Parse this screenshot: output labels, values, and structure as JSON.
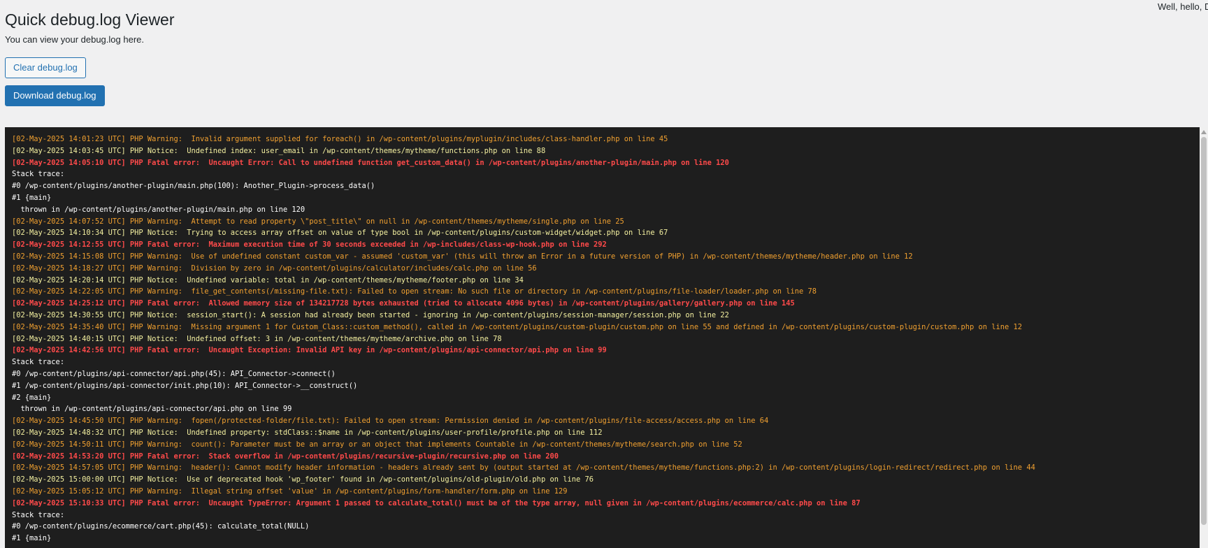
{
  "header": {
    "greeting": "Well, hello, Do"
  },
  "page": {
    "title": "Quick debug.log Viewer",
    "subtitle": "You can view your debug.log here."
  },
  "buttons": {
    "clear_label": "Clear debug.log",
    "download_label": "Download debug.log"
  },
  "colors": {
    "warning": "#f0a030",
    "notice": "#f4f0a0",
    "fatal": "#ff4a4a",
    "plain": "#ffffff",
    "primary": "#2271b1"
  },
  "log": [
    {
      "level": "warning",
      "text": "[02-May-2025 14:01:23 UTC] PHP Warning:  Invalid argument supplied for foreach() in /wp-content/plugins/myplugin/includes/class-handler.php on line 45"
    },
    {
      "level": "notice",
      "text": "[02-May-2025 14:03:45 UTC] PHP Notice:  Undefined index: user_email in /wp-content/themes/mytheme/functions.php on line 88"
    },
    {
      "level": "fatal",
      "text": "[02-May-2025 14:05:10 UTC] PHP Fatal error:  Uncaught Error: Call to undefined function get_custom_data() in /wp-content/plugins/another-plugin/main.php on line 120"
    },
    {
      "level": "plain",
      "text": "Stack trace:"
    },
    {
      "level": "plain",
      "text": "#0 /wp-content/plugins/another-plugin/main.php(100): Another_Plugin->process_data()"
    },
    {
      "level": "plain",
      "text": "#1 {main}"
    },
    {
      "level": "plain",
      "text": "  thrown in /wp-content/plugins/another-plugin/main.php on line 120"
    },
    {
      "level": "warning",
      "text": "[02-May-2025 14:07:52 UTC] PHP Warning:  Attempt to read property \\\"post_title\\\" on null in /wp-content/themes/mytheme/single.php on line 25"
    },
    {
      "level": "notice",
      "text": "[02-May-2025 14:10:34 UTC] PHP Notice:  Trying to access array offset on value of type bool in /wp-content/plugins/custom-widget/widget.php on line 67"
    },
    {
      "level": "fatal",
      "text": "[02-May-2025 14:12:55 UTC] PHP Fatal error:  Maximum execution time of 30 seconds exceeded in /wp-includes/class-wp-hook.php on line 292"
    },
    {
      "level": "warning",
      "text": "[02-May-2025 14:15:08 UTC] PHP Warning:  Use of undefined constant custom_var - assumed 'custom_var' (this will throw an Error in a future version of PHP) in /wp-content/themes/mytheme/header.php on line 12"
    },
    {
      "level": "warning",
      "text": "[02-May-2025 14:18:27 UTC] PHP Warning:  Division by zero in /wp-content/plugins/calculator/includes/calc.php on line 56"
    },
    {
      "level": "notice",
      "text": "[02-May-2025 14:20:14 UTC] PHP Notice:  Undefined variable: total in /wp-content/themes/mytheme/footer.php on line 34"
    },
    {
      "level": "warning",
      "text": "[02-May-2025 14:22:05 UTC] PHP Warning:  file_get_contents(/missing-file.txt): Failed to open stream: No such file or directory in /wp-content/plugins/file-loader/loader.php on line 78"
    },
    {
      "level": "fatal",
      "text": "[02-May-2025 14:25:12 UTC] PHP Fatal error:  Allowed memory size of 134217728 bytes exhausted (tried to allocate 4096 bytes) in /wp-content/plugins/gallery/gallery.php on line 145"
    },
    {
      "level": "notice",
      "text": "[02-May-2025 14:30:55 UTC] PHP Notice:  session_start(): A session had already been started - ignoring in /wp-content/plugins/session-manager/session.php on line 22"
    },
    {
      "level": "warning",
      "text": "[02-May-2025 14:35:40 UTC] PHP Warning:  Missing argument 1 for Custom_Class::custom_method(), called in /wp-content/plugins/custom-plugin/custom.php on line 55 and defined in /wp-content/plugins/custom-plugin/custom.php on line 12"
    },
    {
      "level": "notice",
      "text": "[02-May-2025 14:40:15 UTC] PHP Notice:  Undefined offset: 3 in /wp-content/themes/mytheme/archive.php on line 78"
    },
    {
      "level": "fatal",
      "text": "[02-May-2025 14:42:56 UTC] PHP Fatal error:  Uncaught Exception: Invalid API key in /wp-content/plugins/api-connector/api.php on line 99"
    },
    {
      "level": "plain",
      "text": "Stack trace:"
    },
    {
      "level": "plain",
      "text": "#0 /wp-content/plugins/api-connector/api.php(45): API_Connector->connect()"
    },
    {
      "level": "plain",
      "text": "#1 /wp-content/plugins/api-connector/init.php(10): API_Connector->__construct()"
    },
    {
      "level": "plain",
      "text": "#2 {main}"
    },
    {
      "level": "plain",
      "text": "  thrown in /wp-content/plugins/api-connector/api.php on line 99"
    },
    {
      "level": "warning",
      "text": "[02-May-2025 14:45:50 UTC] PHP Warning:  fopen(/protected-folder/file.txt): Failed to open stream: Permission denied in /wp-content/plugins/file-access/access.php on line 64"
    },
    {
      "level": "notice",
      "text": "[02-May-2025 14:48:32 UTC] PHP Notice:  Undefined property: stdClass::$name in /wp-content/plugins/user-profile/profile.php on line 112"
    },
    {
      "level": "warning",
      "text": "[02-May-2025 14:50:11 UTC] PHP Warning:  count(): Parameter must be an array or an object that implements Countable in /wp-content/themes/mytheme/search.php on line 52"
    },
    {
      "level": "fatal",
      "text": "[02-May-2025 14:53:20 UTC] PHP Fatal error:  Stack overflow in /wp-content/plugins/recursive-plugin/recursive.php on line 200"
    },
    {
      "level": "warning",
      "text": "[02-May-2025 14:57:05 UTC] PHP Warning:  header(): Cannot modify header information - headers already sent by (output started at /wp-content/themes/mytheme/functions.php:2) in /wp-content/plugins/login-redirect/redirect.php on line 44"
    },
    {
      "level": "notice",
      "text": "[02-May-2025 15:00:00 UTC] PHP Notice:  Use of deprecated hook 'wp_footer' found in /wp-content/plugins/old-plugin/old.php on line 76"
    },
    {
      "level": "warning",
      "text": "[02-May-2025 15:05:12 UTC] PHP Warning:  Illegal string offset 'value' in /wp-content/plugins/form-handler/form.php on line 129"
    },
    {
      "level": "fatal",
      "text": "[02-May-2025 15:10:33 UTC] PHP Fatal error:  Uncaught TypeError: Argument 1 passed to calculate_total() must be of the type array, null given in /wp-content/plugins/ecommerce/calc.php on line 87"
    },
    {
      "level": "plain",
      "text": "Stack trace:"
    },
    {
      "level": "plain",
      "text": "#0 /wp-content/plugins/ecommerce/cart.php(45): calculate_total(NULL)"
    },
    {
      "level": "plain",
      "text": "#1 {main}"
    }
  ]
}
